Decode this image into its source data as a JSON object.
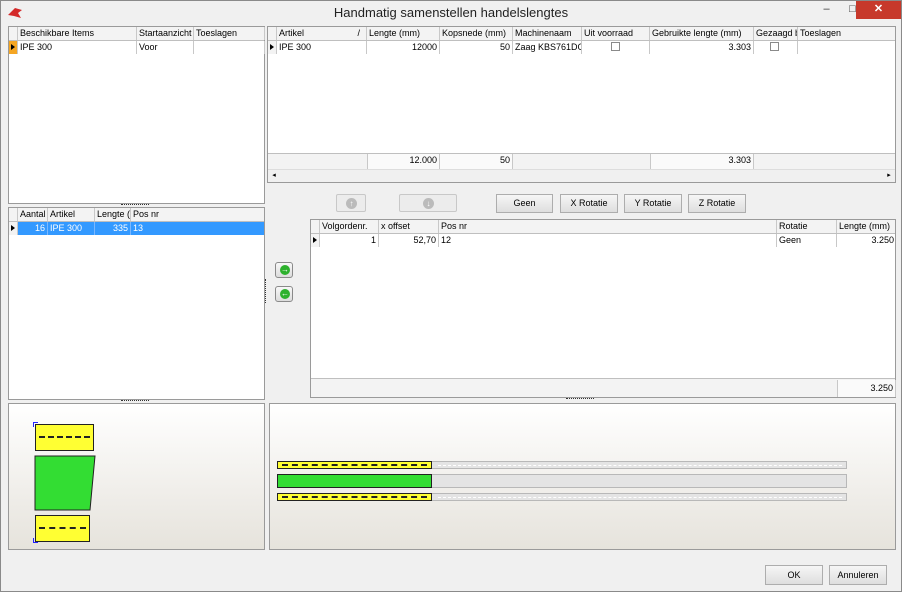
{
  "window": {
    "title": "Handmatig samenstellen handelslengtes",
    "min": "–",
    "max": "□",
    "close": "✕"
  },
  "items": {
    "headers": [
      "Beschikbare Items",
      "Startaanzicht",
      "Toeslagen"
    ],
    "rows": [
      {
        "item": "IPE 300",
        "start": "Voor",
        "toeslagen": ""
      }
    ]
  },
  "positions": {
    "headers": [
      "Aantal",
      "Artikel",
      "Lengte (",
      "Pos nr"
    ],
    "rows": [
      {
        "aantal": "16",
        "artikel": "IPE 300",
        "lengte": "335",
        "pos": "13"
      }
    ]
  },
  "articles": {
    "headers": [
      "Artikel",
      "Lengte (mm)",
      "Kopsnede (mm)",
      "Machinenaam",
      "Uit voorraad",
      "Gebruikte lengte (mm)",
      "Gezaagd b",
      "Toeslagen"
    ],
    "sort_indicator": "/",
    "rows": [
      {
        "artikel": "IPE 300",
        "lengte": "12000",
        "kopsnede": "50",
        "machine": "Zaag KBS761DG",
        "uit_voorraad": false,
        "gebruikt": "3.303",
        "gezaagd": false,
        "toeslagen": ""
      }
    ],
    "totals": {
      "lengte": "12.000",
      "kopsnede": "50",
      "gebruikt": "3.303"
    }
  },
  "buttons": {
    "up": "↑",
    "down": "↓",
    "geen": "Geen",
    "x_rot": "X Rotatie",
    "y_rot": "Y Rotatie",
    "z_rot": "Z Rotatie",
    "add": "→",
    "remove": "←",
    "ok": "OK",
    "cancel": "Annuleren"
  },
  "placed": {
    "headers": [
      "Volgordenr.",
      "x offset",
      "Pos nr",
      "Rotatie",
      "Lengte (mm)"
    ],
    "rows": [
      {
        "volg": "1",
        "xoffset": "52,70",
        "pos": "12",
        "rotatie": "Geen",
        "lengte": "3.250"
      }
    ],
    "total": "3.250"
  },
  "colors": {
    "profile": "#ffff33",
    "profile_side": "#33dd33",
    "remaining": "#e4e4e4"
  }
}
